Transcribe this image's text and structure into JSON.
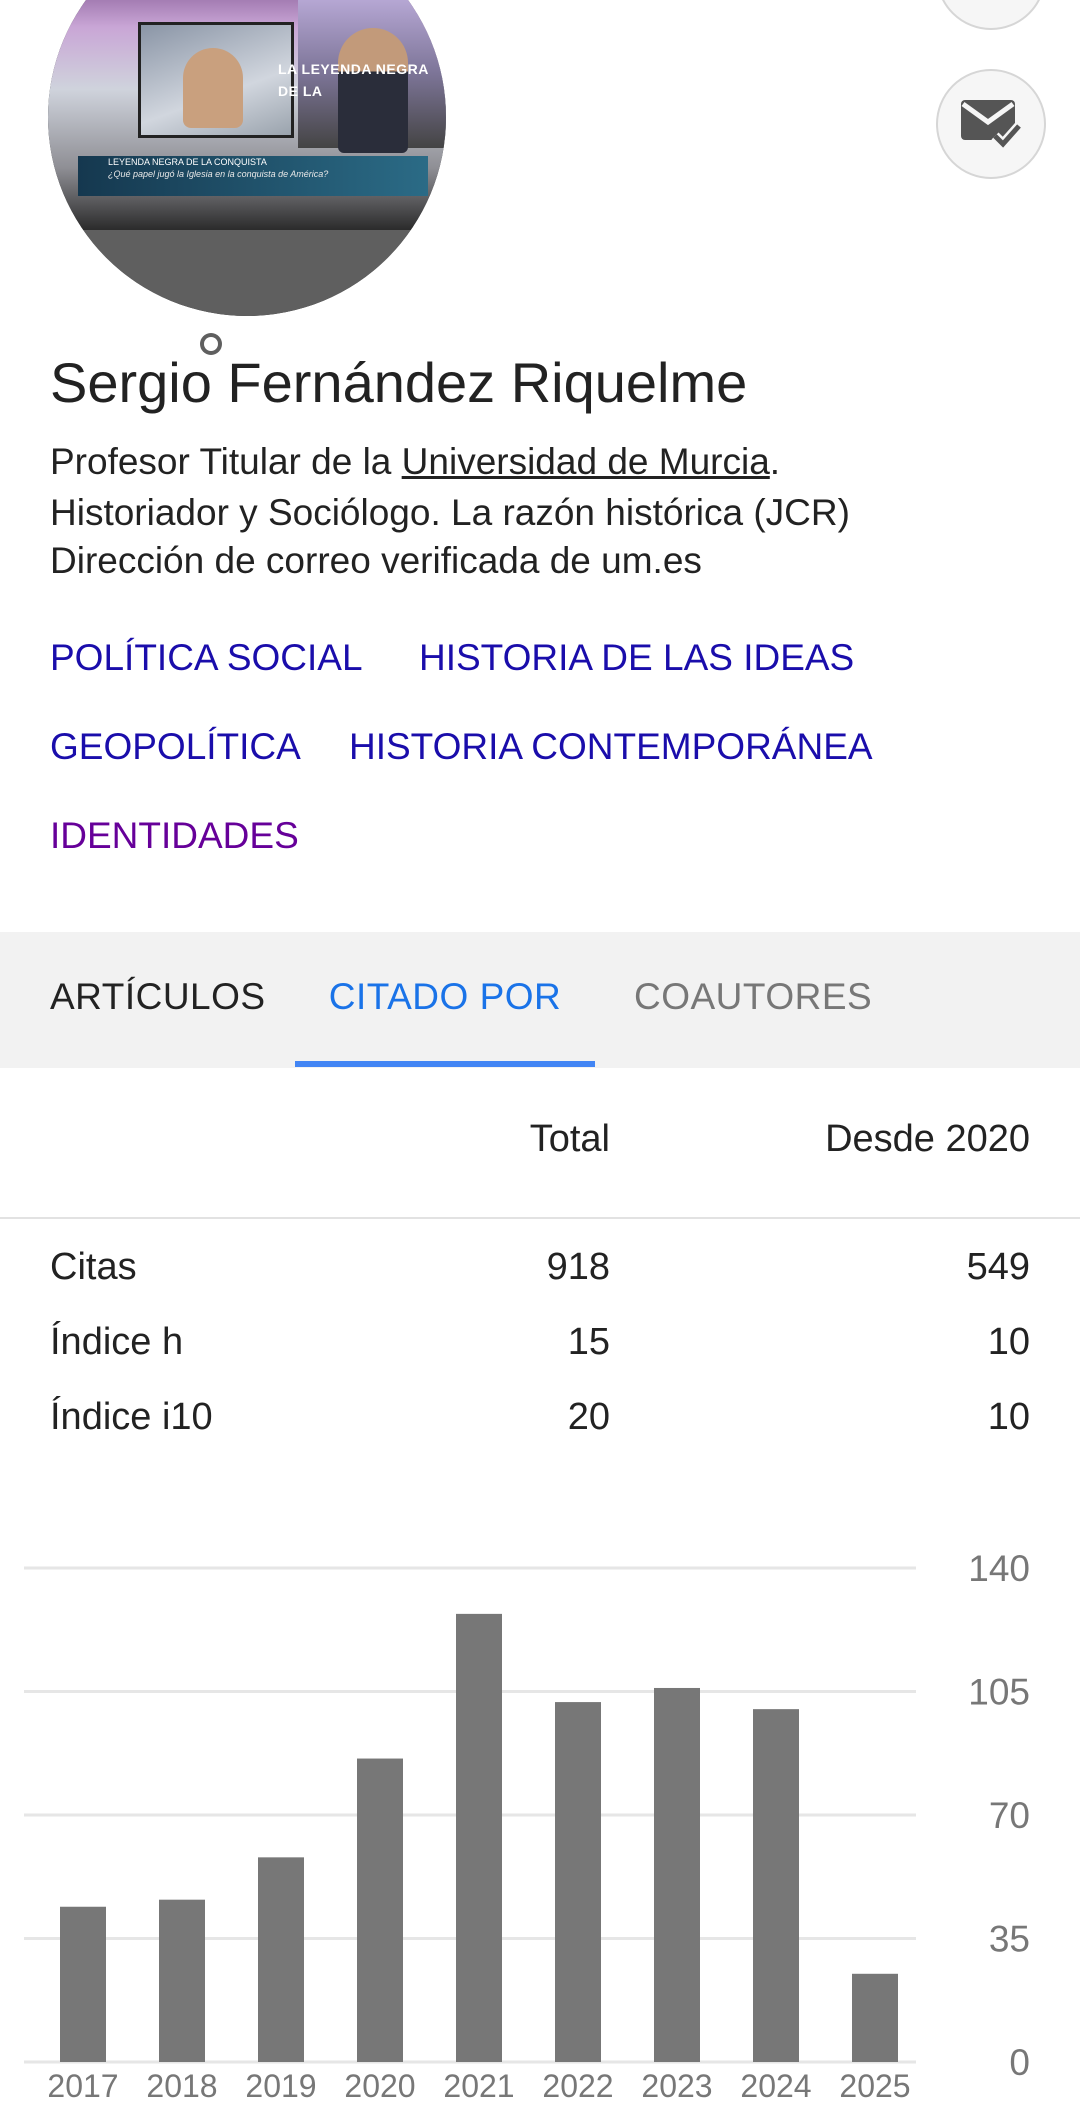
{
  "profile": {
    "name": "Sergio Fernández Riquelme",
    "affiliation_prefix": "Profesor Titular de la ",
    "affiliation_link": "Universidad de Murcia",
    "affiliation_suffix": ".",
    "affiliation_line2": "Historiador y Sociólogo. La razón histórica (JCR)",
    "verified_email": "Dirección de correo verificada de um.es",
    "photo_text": {
      "screen_line1": "LA LEYENDA NEGRA",
      "screen_line2": "DE LA",
      "banner_title": "LEYENDA NEGRA DE LA CONQUISTA",
      "banner_subtitle": "¿Qué papel jugó la Iglesia en la conquista de América?"
    }
  },
  "interests": [
    {
      "label": "POLÍTICA SOCIAL",
      "visited": false
    },
    {
      "label": "HISTORIA DE LAS IDEAS",
      "visited": false
    },
    {
      "label": "GEOPOLÍTICA",
      "visited": false
    },
    {
      "label": "HISTORIA CONTEMPORÁNEA",
      "visited": false
    },
    {
      "label": "IDENTIDADES",
      "visited": true
    }
  ],
  "tabs": [
    {
      "label": "ARTÍCULOS",
      "active": false
    },
    {
      "label": "CITADO POR",
      "active": true
    },
    {
      "label": "COAUTORES",
      "active": false
    }
  ],
  "stats": {
    "headers": [
      "Total",
      "Desde 2020"
    ],
    "rows": [
      {
        "label": "Citas",
        "total": "918",
        "since": "549"
      },
      {
        "label": "Índice h",
        "total": "15",
        "since": "10"
      },
      {
        "label": "Índice i10",
        "total": "20",
        "since": "10"
      }
    ]
  },
  "colors": {
    "link": "#1a0dab",
    "visited_link": "#660099",
    "active_tab": "#1a73e8",
    "tab_indicator": "#4285f4",
    "bar": "#777777"
  },
  "icons": {
    "avatar_action": "add-photo-icon",
    "email_button": "mark-email-read-icon"
  },
  "chart_data": {
    "type": "bar",
    "categories": [
      "2017",
      "2018",
      "2019",
      "2020",
      "2021",
      "2022",
      "2023",
      "2024",
      "2025"
    ],
    "values": [
      44,
      46,
      58,
      86,
      127,
      102,
      106,
      100,
      25
    ],
    "ylim": [
      0,
      140
    ],
    "yticks": [
      "0",
      "35",
      "70",
      "105",
      "140"
    ],
    "grid": true,
    "title": "",
    "xlabel": "",
    "ylabel": ""
  }
}
